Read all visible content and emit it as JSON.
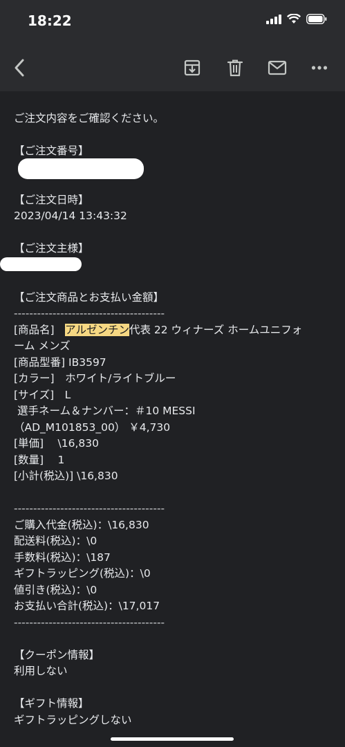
{
  "status_bar": {
    "time": "18:22"
  },
  "email": {
    "intro": "ご注文内容をご確認ください。",
    "order_number_header": "【ご注文番号】",
    "order_date_header": "【ご注文日時】",
    "order_date_value": "2023/04/14 13:43:32",
    "customer_header": "【ご注文主様】",
    "items_header": "【ご注文商品とお支払い金額】",
    "separator": "---------------------------------------",
    "product_name_label": "[商品名]",
    "product_name_highlight": "アルゼンチン",
    "product_name_rest": "代表 22 ウィナーズ ホームユニフォ",
    "product_name_line2": "ーム メンズ",
    "model_line": "[商品型番] IB3597",
    "color_line": "[カラー]　ホワイト/ライトブルー",
    "size_line": "[サイズ]　L",
    "player_line": " 選手ネーム＆ナンバー：＃10 MESSI",
    "player_code_line": "（AD_M101853_00） ￥4,730",
    "unit_price_line": "[単価]　 \\16,830",
    "quantity_line": "[数量]　 1",
    "subtotal_line": "[小計(税込)] \\16,830",
    "purchase_total_line": "ご購入代金(税込)：\\16,830",
    "shipping_line": "配送料(税込)：\\0",
    "fee_line": "手数料(税込)：\\187",
    "gift_wrap_fee_line": "ギフトラッピング(税込)：\\0",
    "discount_line": "値引き(税込)：\\0",
    "grand_total_line": "お支払い合計(税込)：\\17,017",
    "coupon_header": "【クーポン情報】",
    "coupon_value": "利用しない",
    "gift_header": "【ギフト情報】",
    "gift_value": "ギフトラッピングしない"
  },
  "icons": {
    "back": "back-arrow-icon",
    "archive": "archive-icon",
    "delete": "trash-icon",
    "mark_unread": "mail-icon",
    "more": "more-icon"
  },
  "colors": {
    "background": "#202124",
    "toolbar": "#2b2c2f",
    "highlight": "#f6d883",
    "text": "#e8eaed"
  }
}
